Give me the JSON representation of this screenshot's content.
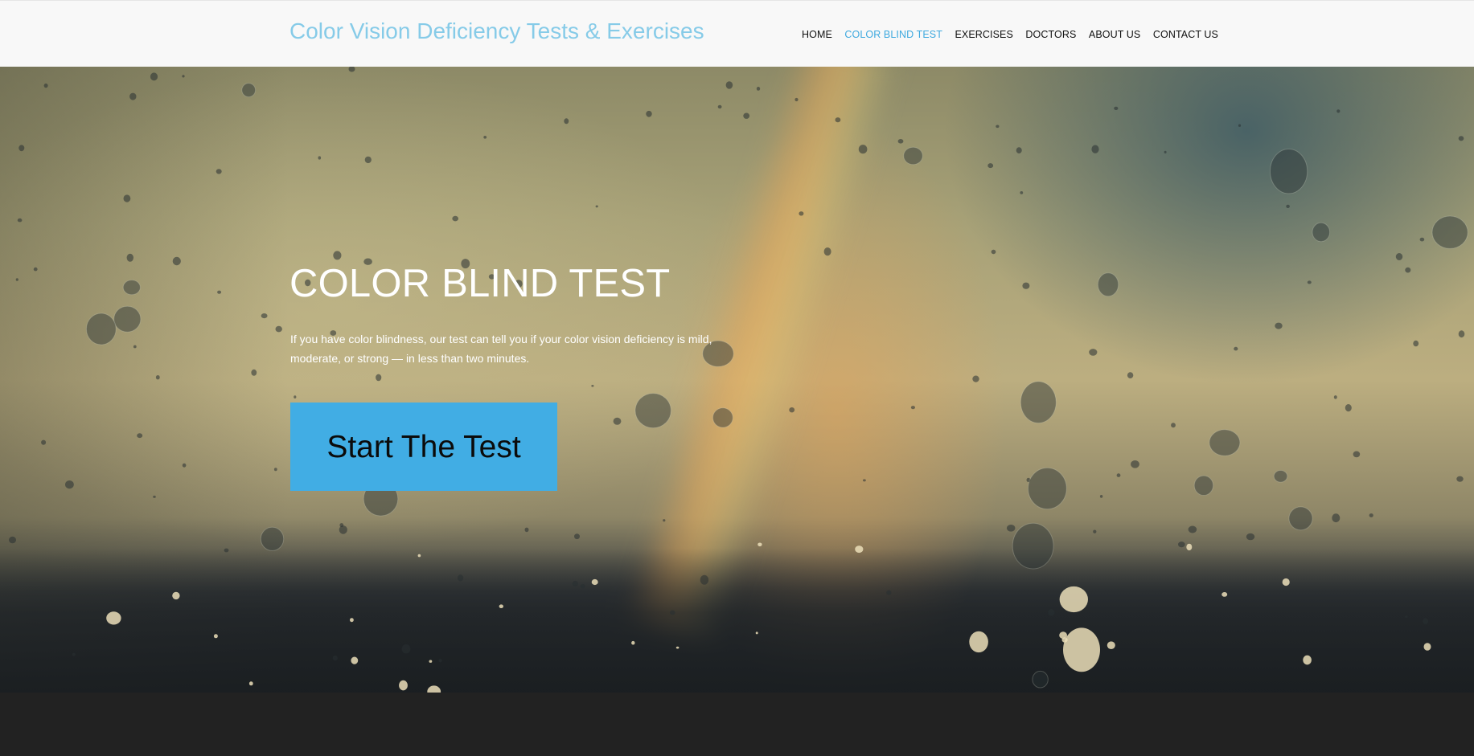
{
  "header": {
    "site_title": "Color Vision Deficiency Tests & Exercises",
    "nav": [
      {
        "label": "HOME",
        "active": false
      },
      {
        "label": "COLOR BLIND TEST",
        "active": true
      },
      {
        "label": "EXERCISES",
        "active": false
      },
      {
        "label": "DOCTORS",
        "active": false
      },
      {
        "label": "ABOUT US",
        "active": false
      },
      {
        "label": "CONTACT US",
        "active": false
      }
    ]
  },
  "hero": {
    "title": "COLOR BLIND TEST",
    "description": "If you have color blindness, our test can tell you if your color vision deficiency is mild, moderate, or strong — in less than two minutes.",
    "cta_label": "Start The Test"
  },
  "colors": {
    "title_accent": "#86cbe8",
    "nav_active": "#3ea9df",
    "cta_background": "#41ade4",
    "header_background": "#f8f8f8",
    "footer_background": "#222222"
  }
}
